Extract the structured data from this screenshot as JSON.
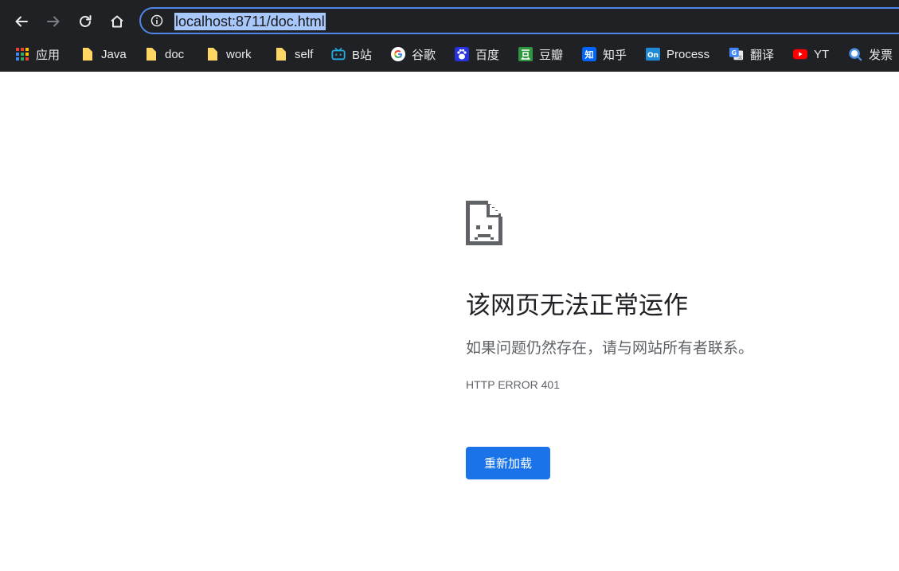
{
  "browser": {
    "url": "localhost:8711/doc.html",
    "accent_color": "#4f86e8",
    "toolbar_bg": "#202124"
  },
  "bookmarks": [
    {
      "label": "应用",
      "icon": "apps-grid-icon"
    },
    {
      "label": "Java",
      "icon": "folder-icon"
    },
    {
      "label": "doc",
      "icon": "folder-icon"
    },
    {
      "label": "work",
      "icon": "folder-icon"
    },
    {
      "label": "self",
      "icon": "folder-icon"
    },
    {
      "label": "B站",
      "icon": "bilibili-icon"
    },
    {
      "label": "谷歌",
      "icon": "google-icon"
    },
    {
      "label": "百度",
      "icon": "baidu-icon"
    },
    {
      "label": "豆瓣",
      "icon": "douban-icon"
    },
    {
      "label": "知乎",
      "icon": "zhihu-icon"
    },
    {
      "label": "Process",
      "icon": "processon-icon"
    },
    {
      "label": "翻译",
      "icon": "translate-icon"
    },
    {
      "label": "YT",
      "icon": "youtube-icon"
    },
    {
      "label": "发票",
      "icon": "invoice-icon"
    }
  ],
  "error": {
    "title": "该网页无法正常运作",
    "message": "如果问题仍然存在，请与网站所有者联系。",
    "code": "HTTP ERROR 401",
    "reload_label": "重新加载",
    "button_color": "#1a73e8"
  }
}
